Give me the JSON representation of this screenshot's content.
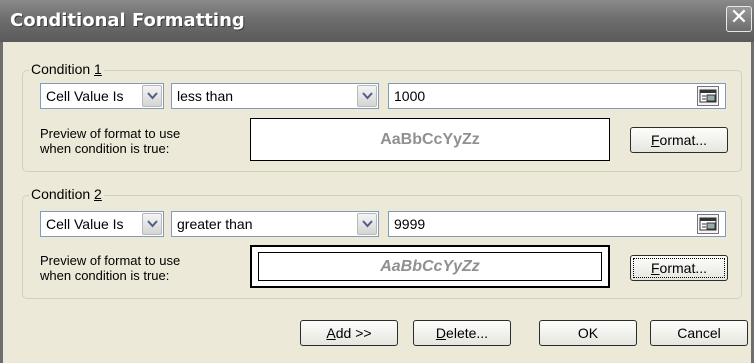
{
  "window": {
    "title": "Conditional Formatting",
    "close_glyph": "✕"
  },
  "conditions": [
    {
      "legend_prefix": "Condition ",
      "legend_number": "1",
      "type_value": "Cell Value Is",
      "operator_value": "less than",
      "value": "1000",
      "preview_label_line1": "Preview of format to use",
      "preview_label_line2": "when condition is true:",
      "preview_text": "AaBbCcYyZz",
      "preview_italic": false,
      "format_button": {
        "mnemonic": "F",
        "rest": "ormat..."
      }
    },
    {
      "legend_prefix": "Condition ",
      "legend_number": "2",
      "type_value": "Cell Value Is",
      "operator_value": "greater than",
      "value": "9999",
      "preview_label_line1": "Preview of format to use",
      "preview_label_line2": "when condition is true:",
      "preview_text": "AaBbCcYyZz",
      "preview_italic": true,
      "format_button": {
        "mnemonic": "F",
        "rest": "ormat..."
      }
    }
  ],
  "buttons": {
    "add": {
      "mnemonic": "A",
      "rest": "dd >>"
    },
    "delete": {
      "mnemonic": "D",
      "rest": "elete..."
    },
    "ok": "OK",
    "cancel": "Cancel"
  },
  "icons": {
    "dropdown": "chevron-down-icon",
    "collapse": "collapse-dialog-icon",
    "close": "close-icon"
  },
  "colors": {
    "title_bar": "#6e6e6e",
    "dialog_bg": "#ece9d8",
    "preview_text": "#909090",
    "field_border": "#7f9db9"
  }
}
